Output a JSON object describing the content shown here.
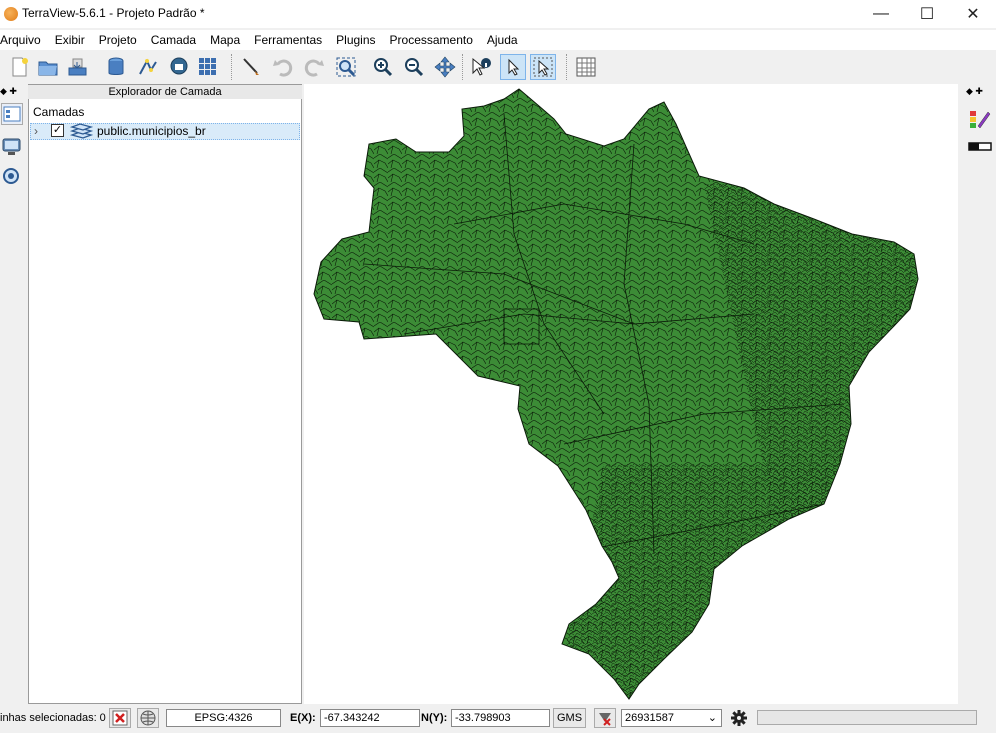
{
  "window": {
    "title": "TerraView-5.6.1 - Projeto Padrão *",
    "minimize_glyph": "—",
    "maximize_glyph": "☐",
    "close_glyph": "✕"
  },
  "menu": [
    "Arquivo",
    "Exibir",
    "Projeto",
    "Camada",
    "Mapa",
    "Ferramentas",
    "Plugins",
    "Processamento",
    "Ajuda"
  ],
  "toolbar": {
    "icons": [
      "new-project-icon",
      "open-project-icon",
      "save-project-icon",
      "add-database-icon",
      "add-vector-icon",
      "add-postgis-icon",
      "grid-icon",
      "draw-icon",
      "undo-icon",
      "redo-icon",
      "zoom-extent-icon",
      "zoom-in-icon",
      "zoom-out-icon",
      "pan-icon",
      "info-icon",
      "select-icon",
      "select-area-icon",
      "table-icon"
    ]
  },
  "explorer": {
    "title": "Explorador de Camada",
    "root_label": "Camadas",
    "layer": {
      "name": "public.municipios_br",
      "checked": true,
      "check_glyph": "✓",
      "chevron": "›"
    }
  },
  "map": {
    "fill_color": "#3c8c36",
    "stroke_color": "#0a1a08"
  },
  "status": {
    "selected_label": "inhas selecionadas: 0",
    "srs": "EPSG:4326",
    "x_label": "E(X):",
    "x_value": "-67.343242",
    "y_label": "N(Y):",
    "y_value": "-33.798903",
    "coord_format_button": "GMS",
    "scale_value": "26931587",
    "dropdown_glyph": "⌄"
  },
  "colors": {
    "accent": "#7eb4ea",
    "selection": "#d9ebf9",
    "map_green": "#3c8c36"
  }
}
